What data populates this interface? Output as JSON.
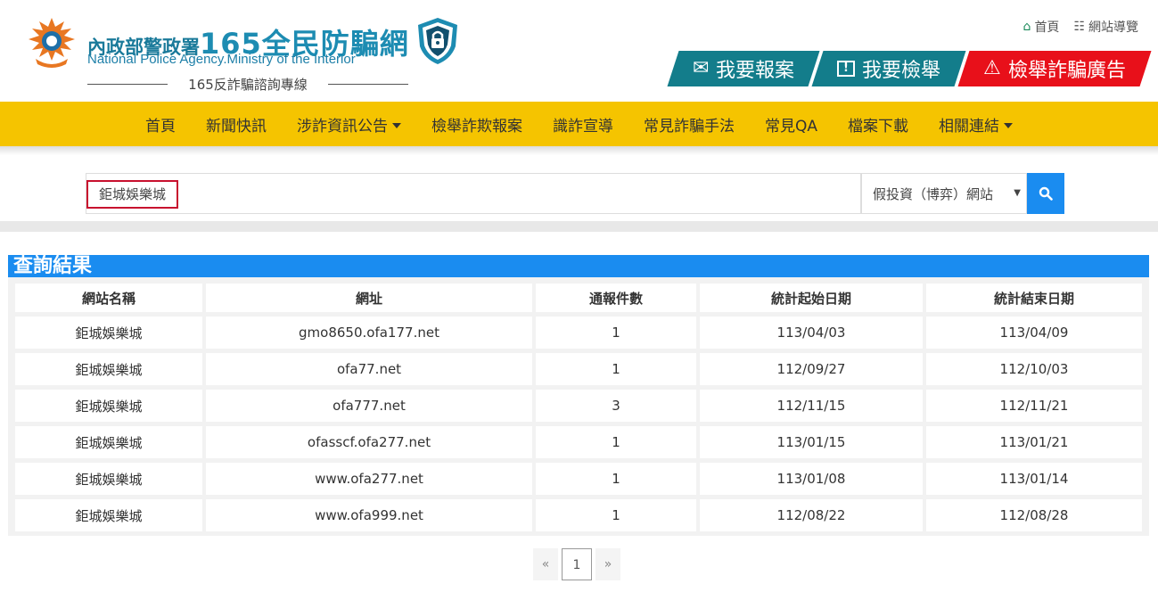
{
  "brand": {
    "agency_zh": "內政部警政署",
    "site_name": "165全民防騙網",
    "agency_en": "National Police Agency.Ministry of the Interior",
    "hotline": "165反詐騙諮詢專線"
  },
  "toplinks": {
    "home": "首頁",
    "sitemap": "網站導覽"
  },
  "actions": {
    "report": "我要報案",
    "inform": "我要檢舉",
    "ad_report": "檢舉詐騙廣告"
  },
  "nav": [
    {
      "label": "首頁",
      "dropdown": false
    },
    {
      "label": "新聞快訊",
      "dropdown": false
    },
    {
      "label": "涉詐資訊公告",
      "dropdown": true
    },
    {
      "label": "檢舉詐欺報案",
      "dropdown": false
    },
    {
      "label": "識詐宣導",
      "dropdown": false
    },
    {
      "label": "常見詐騙手法",
      "dropdown": false
    },
    {
      "label": "常見QA",
      "dropdown": false
    },
    {
      "label": "檔案下載",
      "dropdown": false
    },
    {
      "label": "相關連結",
      "dropdown": true
    }
  ],
  "search": {
    "value": "鉅城娛樂城",
    "category": "假投資（博弈）網站"
  },
  "results": {
    "title": "查詢結果",
    "headers": [
      "網站名稱",
      "網址",
      "通報件數",
      "統計起始日期",
      "統計結束日期"
    ],
    "rows": [
      [
        "鉅城娛樂城",
        "gmo8650.ofa177.net",
        "1",
        "113/04/03",
        "113/04/09"
      ],
      [
        "鉅城娛樂城",
        "ofa77.net",
        "1",
        "112/09/27",
        "112/10/03"
      ],
      [
        "鉅城娛樂城",
        "ofa777.net",
        "3",
        "112/11/15",
        "112/11/21"
      ],
      [
        "鉅城娛樂城",
        "ofasscf.ofa277.net",
        "1",
        "113/01/15",
        "113/01/21"
      ],
      [
        "鉅城娛樂城",
        "www.ofa277.net",
        "1",
        "113/01/08",
        "113/01/14"
      ],
      [
        "鉅城娛樂城",
        "www.ofa999.net",
        "1",
        "112/08/22",
        "112/08/28"
      ]
    ]
  },
  "pagination": {
    "prev": "«",
    "current": "1",
    "next": "»"
  },
  "colors": {
    "nav_bg": "#f5c400",
    "action_teal": "#137d8b",
    "action_red": "#e8101a",
    "accent_blue": "#1a8cf0"
  }
}
